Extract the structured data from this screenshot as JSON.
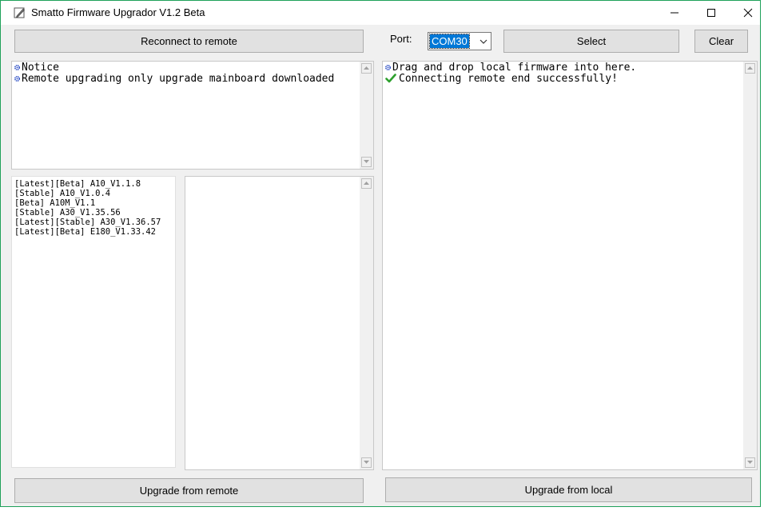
{
  "window": {
    "title": "Smatto Firmware Upgrador V1.2 Beta",
    "frame_color": "#1fa15a"
  },
  "toolbar": {
    "reconnect_label": "Reconnect to remote",
    "port_label": "Port:",
    "port_value": "COM30",
    "select_label": "Select",
    "clear_label": "Clear"
  },
  "notice": {
    "lines": [
      {
        "icon": "gear-bullet-icon",
        "text": "Notice"
      },
      {
        "icon": "gear-bullet-icon",
        "text": "Remote upgrading only upgrade mainboard downloaded"
      }
    ]
  },
  "firmware_list": {
    "items": [
      "[Latest][Beta] A10_V1.1.8",
      "[Stable] A10_V1.0.4",
      "[Beta] A10M_V1.1",
      "[Stable] A30_V1.35.56",
      "[Latest][Stable] A30_V1.36.57",
      "[Latest][Beta] E180_V1.33.42"
    ]
  },
  "log": {
    "lines": [
      {
        "icon": "gear-bullet-icon",
        "text": "Drag and drop local firmware into here."
      },
      {
        "icon": "checkmark-icon",
        "text": "Connecting remote end successfully!"
      }
    ]
  },
  "footer": {
    "upgrade_remote_label": "Upgrade from remote",
    "upgrade_local_label": "Upgrade from local"
  },
  "colors": {
    "accent": "#0078d7",
    "bullet": "#1a3fc0",
    "success": "#2ea02e"
  }
}
